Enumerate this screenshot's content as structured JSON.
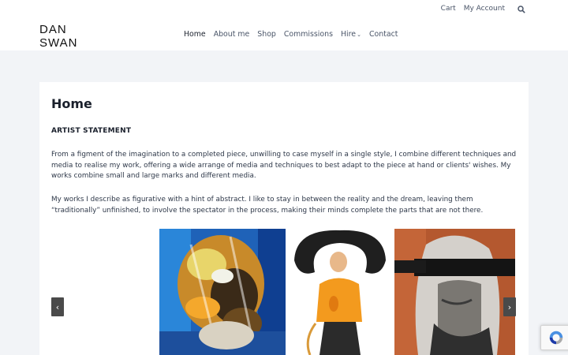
{
  "brand": {
    "line1": "DAN",
    "line2": "SWAN"
  },
  "topbar": {
    "cart": "Cart",
    "account": "My Account",
    "search_icon": "search-icon"
  },
  "nav": {
    "home": "Home",
    "about": "About me",
    "shop": "Shop",
    "commissions": "Commissions",
    "hire": "Hire",
    "hire_chevron": "⌄",
    "contact": "Contact"
  },
  "main": {
    "title": "Home",
    "statement_heading": "ARTIST STATEMENT",
    "paragraph1": "From a figment of the imagination to a completed piece, unwilling to case myself in a single style, I combine different techniques and media to realise my work, offering a wide arrange of media and techniques to best adapt to the piece at hand or clients' wishes. My works combine small and large marks and different media.",
    "paragraph2": "My works I describe as figurative with a hint of abstract. I like to stay in between the reality and the dream, leaving them “traditionally” unfinished, to involve the spectator in the process, making their minds complete the parts that are not there."
  },
  "carousel": {
    "prev_icon": "chevron-left-icon",
    "next_icon": "chevron-right-icon",
    "prev_glyph": "‹",
    "next_glyph": "›",
    "slides": [
      "lion-painting",
      "figure-painting",
      "blindfolded-woman-painting"
    ]
  },
  "colors": {
    "accent": "#1a202c",
    "background": "#f2f4f7",
    "arrow": "#4a4a4a"
  }
}
